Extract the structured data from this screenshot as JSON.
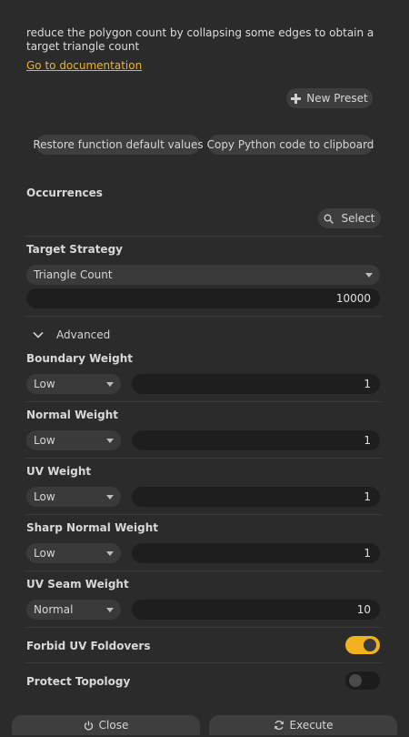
{
  "description": "reduce the polygon count by collapsing some edges to obtain a target triangle count",
  "doc_link": "Go to documentation",
  "new_preset_label": "New Preset",
  "restore_label": "Restore function default values",
  "copy_python_label": "Copy Python code to clipboard",
  "occurrences": {
    "title": "Occurrences",
    "select_label": "Select"
  },
  "target_strategy": {
    "title": "Target Strategy",
    "selected": "Triangle Count",
    "value": "10000"
  },
  "advanced_label": "Advanced",
  "weights": [
    {
      "title": "Boundary Weight",
      "level": "Low",
      "value": "1"
    },
    {
      "title": "Normal Weight",
      "level": "Low",
      "value": "1"
    },
    {
      "title": "UV Weight",
      "level": "Low",
      "value": "1"
    },
    {
      "title": "Sharp Normal Weight",
      "level": "Low",
      "value": "1"
    },
    {
      "title": "UV Seam Weight",
      "level": "Normal",
      "value": "10"
    }
  ],
  "forbid_uv_foldovers": {
    "title": "Forbid UV Foldovers",
    "on": true
  },
  "protect_topology": {
    "title": "Protect Topology",
    "on": false
  },
  "footer": {
    "close_label": "Close",
    "execute_label": "Execute"
  },
  "colors": {
    "accent": "#f2b21e",
    "background": "#2b2b2b"
  }
}
